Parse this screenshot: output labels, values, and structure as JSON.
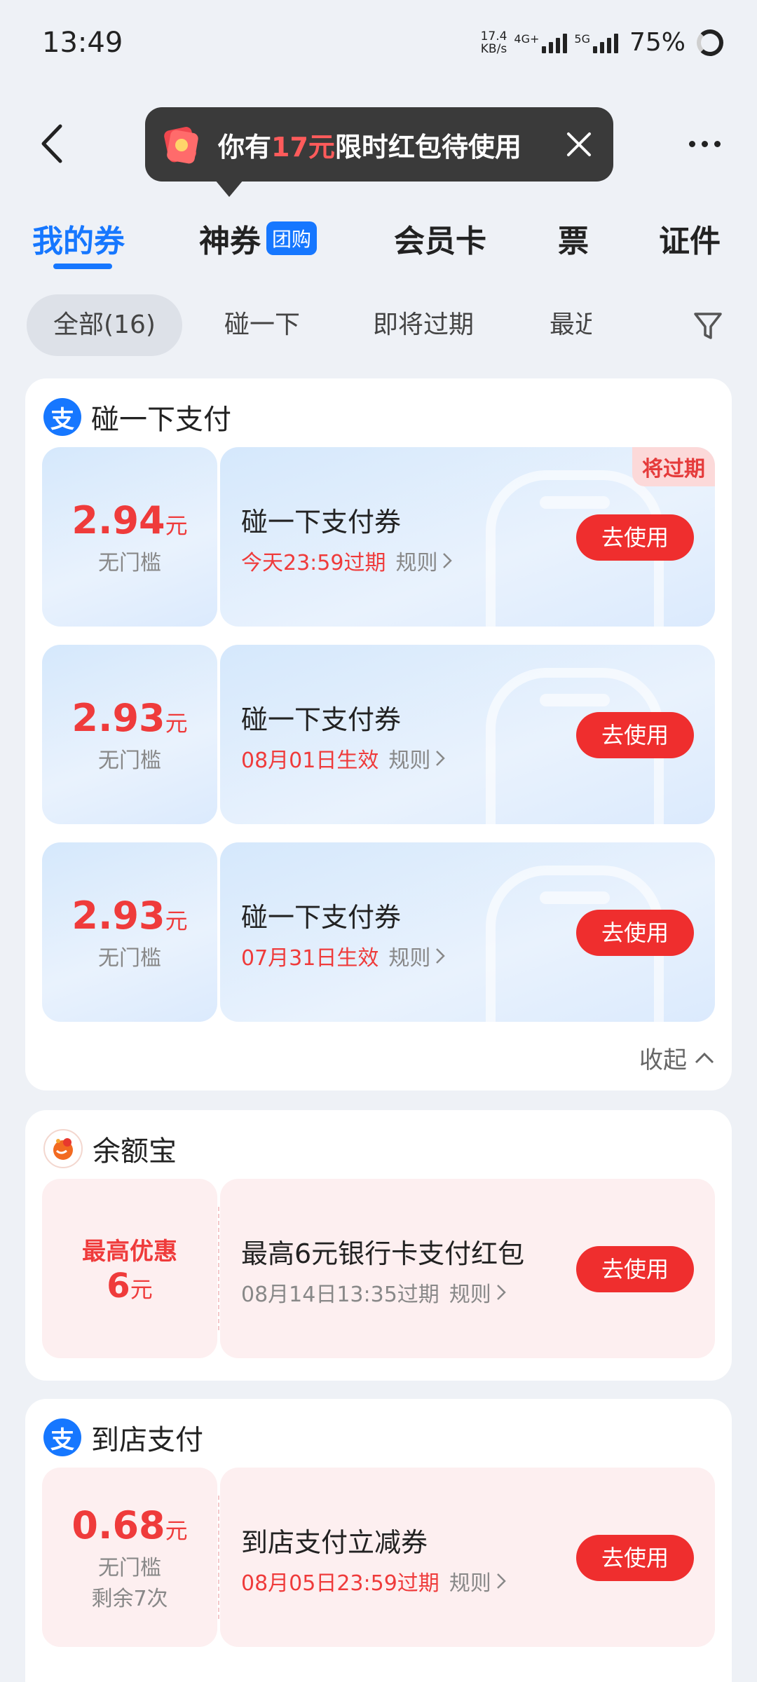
{
  "status": {
    "time": "13:49",
    "net_speed_top": "17.4",
    "net_speed_bottom": "KB/s",
    "sig1_label": "4G+",
    "sig2_label": "5G",
    "battery": "75%"
  },
  "header": {
    "promo_prefix": "你有",
    "promo_amount": "17元",
    "promo_suffix": "限时红包待使用"
  },
  "tabs": [
    {
      "label": "我的券"
    },
    {
      "label": "神券",
      "badge": "团购"
    },
    {
      "label": "会员卡"
    },
    {
      "label": "票"
    },
    {
      "label": "证件"
    }
  ],
  "filters": [
    "全部(16)",
    "碰一下",
    "即将过期",
    "最近"
  ],
  "sections": [
    {
      "title": "碰一下支付",
      "logo_char": "支",
      "coupons": [
        {
          "amount": "2.94",
          "unit": "元",
          "threshold": "无门槛",
          "title": "碰一下支付券",
          "validity": "今天23:59过期",
          "rule": "规则",
          "button": "去使用",
          "badge": "将过期"
        },
        {
          "amount": "2.93",
          "unit": "元",
          "threshold": "无门槛",
          "title": "碰一下支付券",
          "validity": "08月01日生效",
          "rule": "规则",
          "button": "去使用"
        },
        {
          "amount": "2.93",
          "unit": "元",
          "threshold": "无门槛",
          "title": "碰一下支付券",
          "validity": "07月31日生效",
          "rule": "规则",
          "button": "去使用"
        }
      ],
      "collapse_label": "收起"
    },
    {
      "title": "余额宝",
      "coupons": [
        {
          "amount_top": "最高优惠",
          "amount": "6",
          "unit": "元",
          "title": "最高6元银行卡支付红包",
          "validity": "08月14日13:35过期",
          "rule": "规则",
          "button": "去使用"
        }
      ]
    },
    {
      "title": "到店支付",
      "logo_char": "支",
      "coupons": [
        {
          "amount": "0.68",
          "unit": "元",
          "threshold": "无门槛",
          "remaining": "剩余7次",
          "title": "到店支付立减券",
          "validity": "08月05日23:59过期",
          "rule": "规则",
          "button": "去使用"
        }
      ]
    }
  ],
  "colors": {
    "accent": "#1677ff",
    "red": "#ef2e2e",
    "background": "#eef1f6"
  }
}
